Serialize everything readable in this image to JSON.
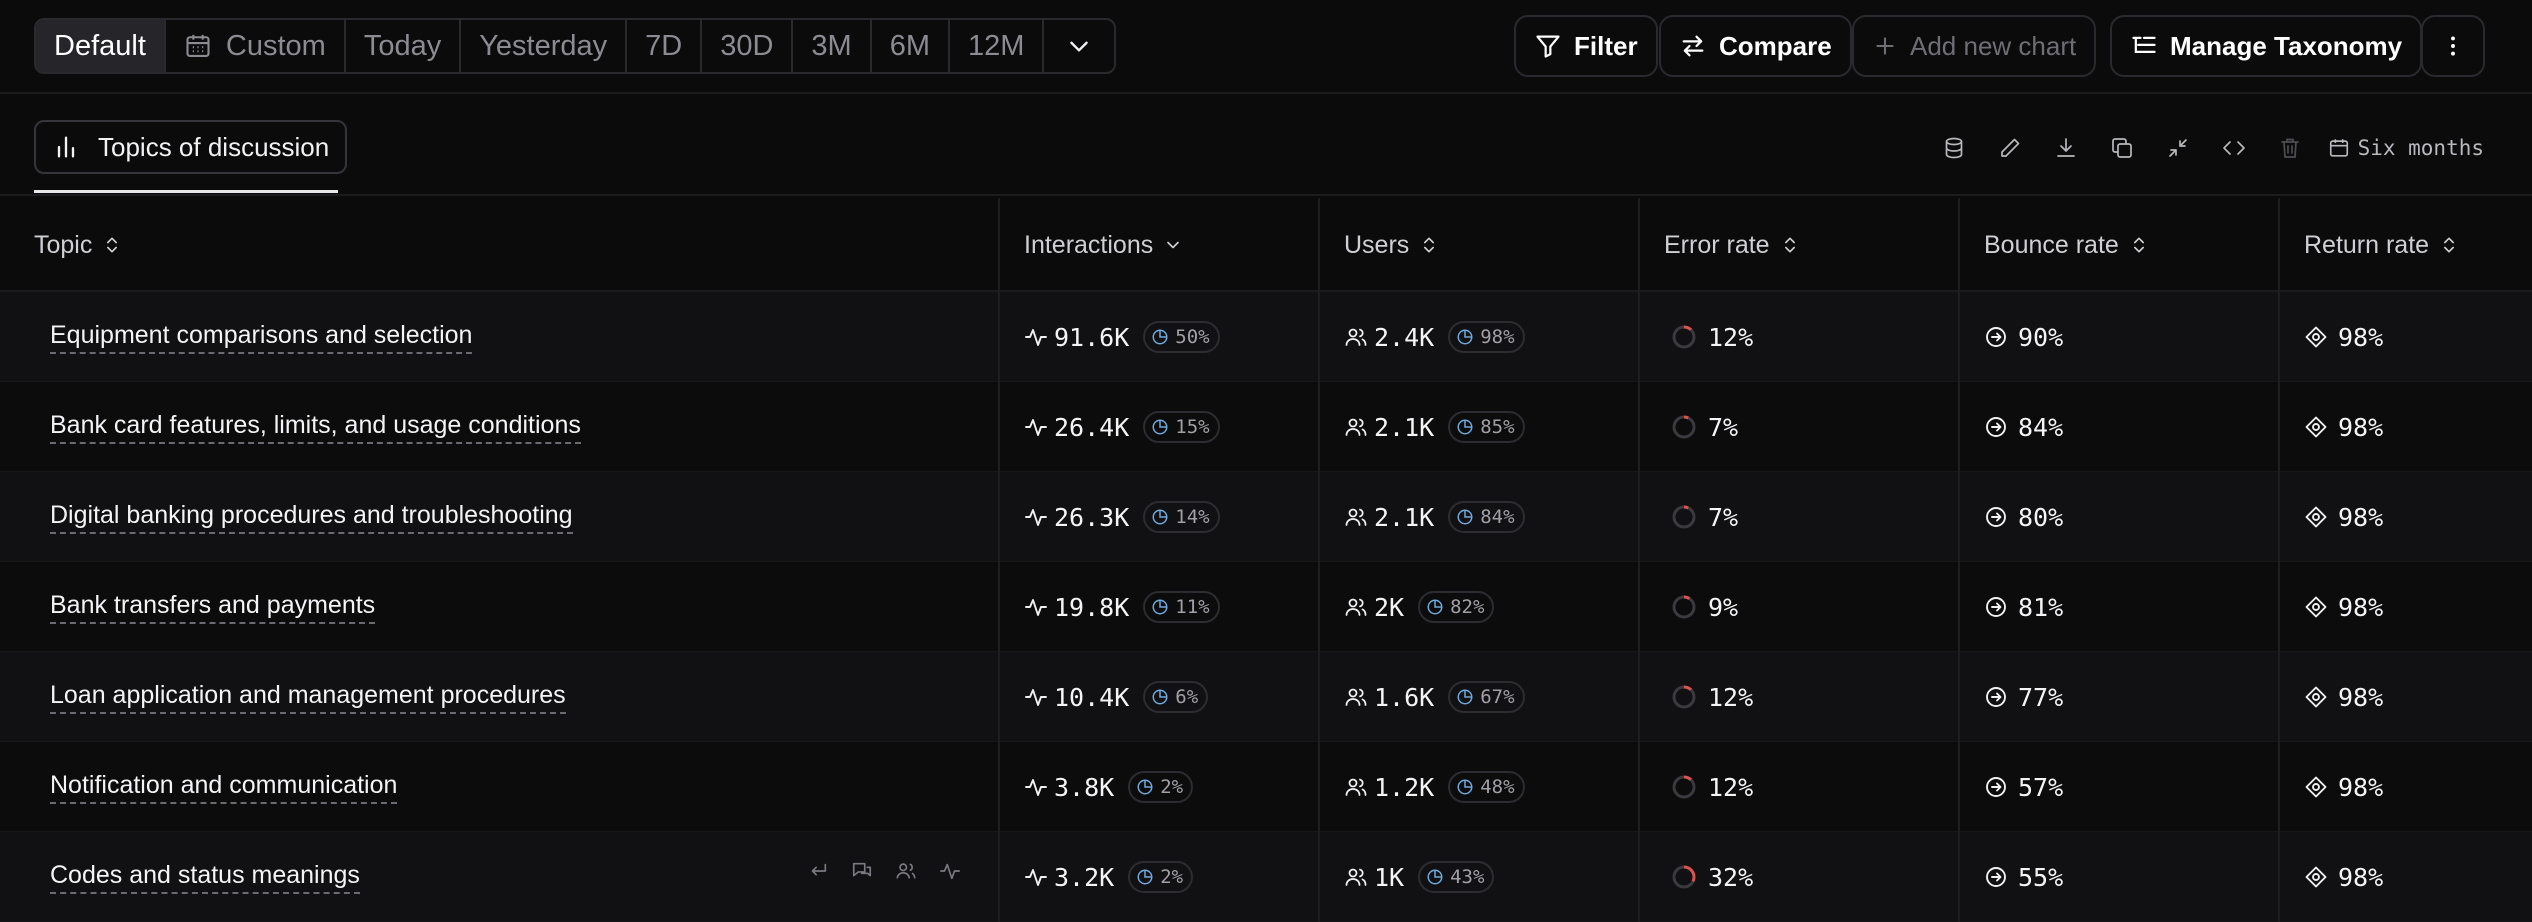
{
  "toolbar": {
    "ranges": [
      "Default",
      "Custom",
      "Today",
      "Yesterday",
      "7D",
      "30D",
      "3M",
      "6M",
      "12M"
    ],
    "active_range": "Default",
    "filter_label": "Filter",
    "compare_label": "Compare",
    "add_chart_label": "Add new chart",
    "taxonomy_label": "Manage Taxonomy"
  },
  "chart": {
    "tab_label": "Topics of discussion",
    "range_label": "Six months"
  },
  "table": {
    "columns": [
      "Topic",
      "Interactions",
      "Users",
      "Error rate",
      "Bounce rate",
      "Return rate"
    ],
    "rows": [
      {
        "topic": "Equipment comparisons and selection",
        "interactions": "91.6K",
        "interactions_pct": "50%",
        "users": "2.4K",
        "users_pct": "98%",
        "error_rate": "12%",
        "bounce_rate": "90%",
        "return_rate": "98%"
      },
      {
        "topic": "Bank card features, limits, and usage conditions",
        "interactions": "26.4K",
        "interactions_pct": "15%",
        "users": "2.1K",
        "users_pct": "85%",
        "error_rate": "7%",
        "bounce_rate": "84%",
        "return_rate": "98%"
      },
      {
        "topic": "Digital banking procedures and troubleshooting",
        "interactions": "26.3K",
        "interactions_pct": "14%",
        "users": "2.1K",
        "users_pct": "84%",
        "error_rate": "7%",
        "bounce_rate": "80%",
        "return_rate": "98%"
      },
      {
        "topic": "Bank transfers and payments",
        "interactions": "19.8K",
        "interactions_pct": "11%",
        "users": "2K",
        "users_pct": "82%",
        "error_rate": "9%",
        "bounce_rate": "81%",
        "return_rate": "98%"
      },
      {
        "topic": "Loan application and management procedures",
        "interactions": "10.4K",
        "interactions_pct": "6%",
        "users": "1.6K",
        "users_pct": "67%",
        "error_rate": "12%",
        "bounce_rate": "77%",
        "return_rate": "98%"
      },
      {
        "topic": "Notification and communication",
        "interactions": "3.8K",
        "interactions_pct": "2%",
        "users": "1.2K",
        "users_pct": "48%",
        "error_rate": "12%",
        "bounce_rate": "57%",
        "return_rate": "98%"
      },
      {
        "topic": "Codes and status meanings",
        "interactions": "3.2K",
        "interactions_pct": "2%",
        "users": "1K",
        "users_pct": "43%",
        "error_rate": "32%",
        "bounce_rate": "55%",
        "return_rate": "98%"
      }
    ]
  },
  "icons": {
    "calendar": "calendar-icon",
    "chevron": "chevron-down-icon",
    "filter": "filter-icon",
    "compare": "compare-arrows-icon",
    "add": "plus-icon",
    "taxonomy": "list-tree-icon",
    "more": "more-vertical-icon",
    "chart": "bar-chart-icon"
  },
  "colors": {
    "background": "#0b0b0c",
    "error_ring": "#d9534f",
    "pill_icon": "#6fa8dc",
    "active_segment": "#26262a"
  }
}
